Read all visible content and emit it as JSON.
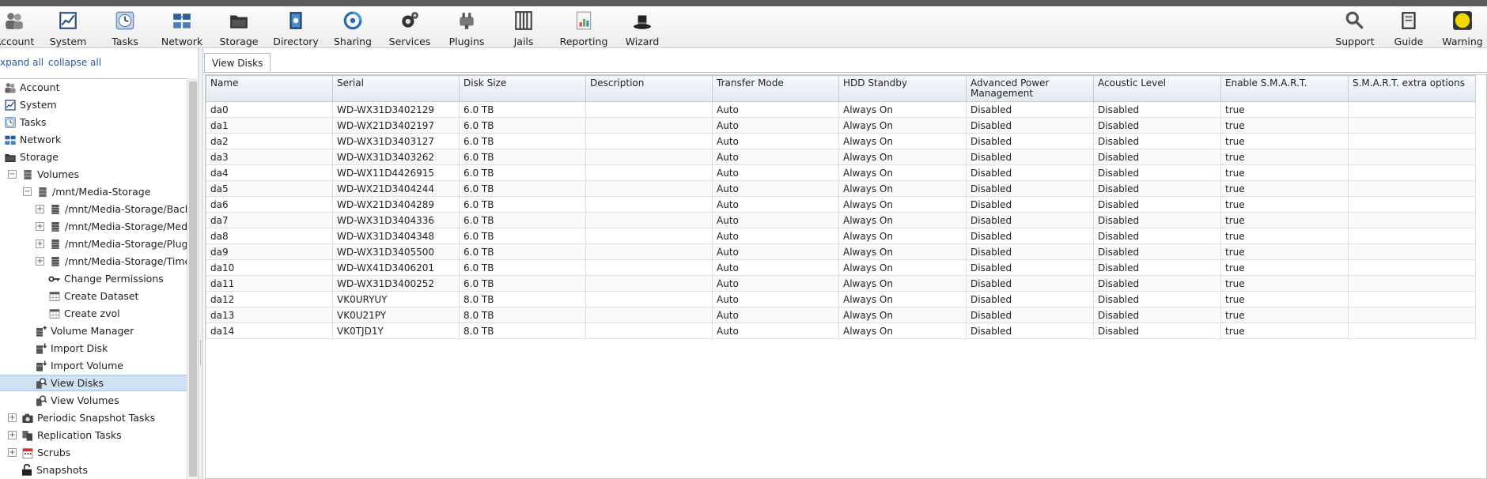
{
  "toolbar": {
    "items": [
      {
        "label": "Account",
        "icon": "account-icon"
      },
      {
        "label": "System",
        "icon": "system-icon"
      },
      {
        "label": "Tasks",
        "icon": "tasks-icon"
      },
      {
        "label": "Network",
        "icon": "network-icon"
      },
      {
        "label": "Storage",
        "icon": "storage-icon"
      },
      {
        "label": "Directory",
        "icon": "directory-icon"
      },
      {
        "label": "Sharing",
        "icon": "sharing-icon"
      },
      {
        "label": "Services",
        "icon": "services-icon"
      },
      {
        "label": "Plugins",
        "icon": "plugins-icon"
      },
      {
        "label": "Jails",
        "icon": "jails-icon"
      },
      {
        "label": "Reporting",
        "icon": "reporting-icon"
      },
      {
        "label": "Wizard",
        "icon": "wizard-icon"
      }
    ],
    "right_items": [
      {
        "label": "Support",
        "icon": "support-icon"
      },
      {
        "label": "Guide",
        "icon": "guide-icon"
      },
      {
        "label": "Warning",
        "icon": "warning-icon"
      }
    ],
    "warning_color": "#f2d600"
  },
  "tree_controls": {
    "expand_all": "xpand all",
    "collapse_all": "collapse all"
  },
  "tree": [
    {
      "label": "Account",
      "icon": "account-icon"
    },
    {
      "label": "System",
      "icon": "system-icon"
    },
    {
      "label": "Tasks",
      "icon": "tasks-icon"
    },
    {
      "label": "Network",
      "icon": "network-icon"
    },
    {
      "label": "Storage",
      "icon": "storage-icon"
    },
    {
      "label": "Volumes",
      "icon": "volume-icon",
      "expander": "−"
    },
    {
      "label": "/mnt/Media-Storage",
      "icon": "volume-icon",
      "expander": "−"
    },
    {
      "label": "/mnt/Media-Storage/Backu",
      "icon": "dataset-icon",
      "expander": "+"
    },
    {
      "label": "/mnt/Media-Storage/Media",
      "icon": "dataset-icon",
      "expander": "+"
    },
    {
      "label": "/mnt/Media-Storage/Plugin",
      "icon": "dataset-icon",
      "expander": "+"
    },
    {
      "label": "/mnt/Media-Storage/TimeM",
      "icon": "dataset-icon",
      "expander": "+"
    },
    {
      "label": "Change Permissions",
      "icon": "key-icon"
    },
    {
      "label": "Create Dataset",
      "icon": "table-icon"
    },
    {
      "label": "Create zvol",
      "icon": "table-icon"
    },
    {
      "label": "Volume Manager",
      "icon": "volume-add-icon"
    },
    {
      "label": "Import Disk",
      "icon": "import-icon"
    },
    {
      "label": "Import Volume",
      "icon": "import-icon"
    },
    {
      "label": "View Disks",
      "icon": "magnifier-icon",
      "selected": true
    },
    {
      "label": "View Volumes",
      "icon": "magnifier-icon"
    },
    {
      "label": "Periodic Snapshot Tasks",
      "icon": "camera-icon",
      "expander": "+"
    },
    {
      "label": "Replication Tasks",
      "icon": "replication-icon",
      "expander": "+"
    },
    {
      "label": "Scrubs",
      "icon": "calendar-icon",
      "expander": "+"
    },
    {
      "label": "Snapshots",
      "icon": "snapshot-icon"
    }
  ],
  "tab": {
    "label": "View Disks"
  },
  "table": {
    "columns": [
      "Name",
      "Serial",
      "Disk Size",
      "Description",
      "Transfer Mode",
      "HDD Standby",
      "Advanced Power Management",
      "Acoustic Level",
      "Enable S.M.A.R.T.",
      "S.M.A.R.T. extra options"
    ],
    "rows": [
      [
        "da0",
        "WD-WX31D3402129",
        "6.0 TB",
        "",
        "Auto",
        "Always On",
        "Disabled",
        "Disabled",
        "true",
        ""
      ],
      [
        "da1",
        "WD-WX21D3402197",
        "6.0 TB",
        "",
        "Auto",
        "Always On",
        "Disabled",
        "Disabled",
        "true",
        ""
      ],
      [
        "da2",
        "WD-WX31D3403127",
        "6.0 TB",
        "",
        "Auto",
        "Always On",
        "Disabled",
        "Disabled",
        "true",
        ""
      ],
      [
        "da3",
        "WD-WX31D3403262",
        "6.0 TB",
        "",
        "Auto",
        "Always On",
        "Disabled",
        "Disabled",
        "true",
        ""
      ],
      [
        "da4",
        "WD-WX11D4426915",
        "6.0 TB",
        "",
        "Auto",
        "Always On",
        "Disabled",
        "Disabled",
        "true",
        ""
      ],
      [
        "da5",
        "WD-WX21D3404244",
        "6.0 TB",
        "",
        "Auto",
        "Always On",
        "Disabled",
        "Disabled",
        "true",
        ""
      ],
      [
        "da6",
        "WD-WX21D3404289",
        "6.0 TB",
        "",
        "Auto",
        "Always On",
        "Disabled",
        "Disabled",
        "true",
        ""
      ],
      [
        "da7",
        "WD-WX31D3404336",
        "6.0 TB",
        "",
        "Auto",
        "Always On",
        "Disabled",
        "Disabled",
        "true",
        ""
      ],
      [
        "da8",
        "WD-WX31D3404348",
        "6.0 TB",
        "",
        "Auto",
        "Always On",
        "Disabled",
        "Disabled",
        "true",
        ""
      ],
      [
        "da9",
        "WD-WX31D3405500",
        "6.0 TB",
        "",
        "Auto",
        "Always On",
        "Disabled",
        "Disabled",
        "true",
        ""
      ],
      [
        "da10",
        "WD-WX41D3406201",
        "6.0 TB",
        "",
        "Auto",
        "Always On",
        "Disabled",
        "Disabled",
        "true",
        ""
      ],
      [
        "da11",
        "WD-WX31D3400252",
        "6.0 TB",
        "",
        "Auto",
        "Always On",
        "Disabled",
        "Disabled",
        "true",
        ""
      ],
      [
        "da12",
        "VK0URYUY",
        "8.0 TB",
        "",
        "Auto",
        "Always On",
        "Disabled",
        "Disabled",
        "true",
        ""
      ],
      [
        "da13",
        "VK0U21PY",
        "8.0 TB",
        "",
        "Auto",
        "Always On",
        "Disabled",
        "Disabled",
        "true",
        ""
      ],
      [
        "da14",
        "VK0TJD1Y",
        "8.0 TB",
        "",
        "Auto",
        "Always On",
        "Disabled",
        "Disabled",
        "true",
        ""
      ]
    ]
  }
}
